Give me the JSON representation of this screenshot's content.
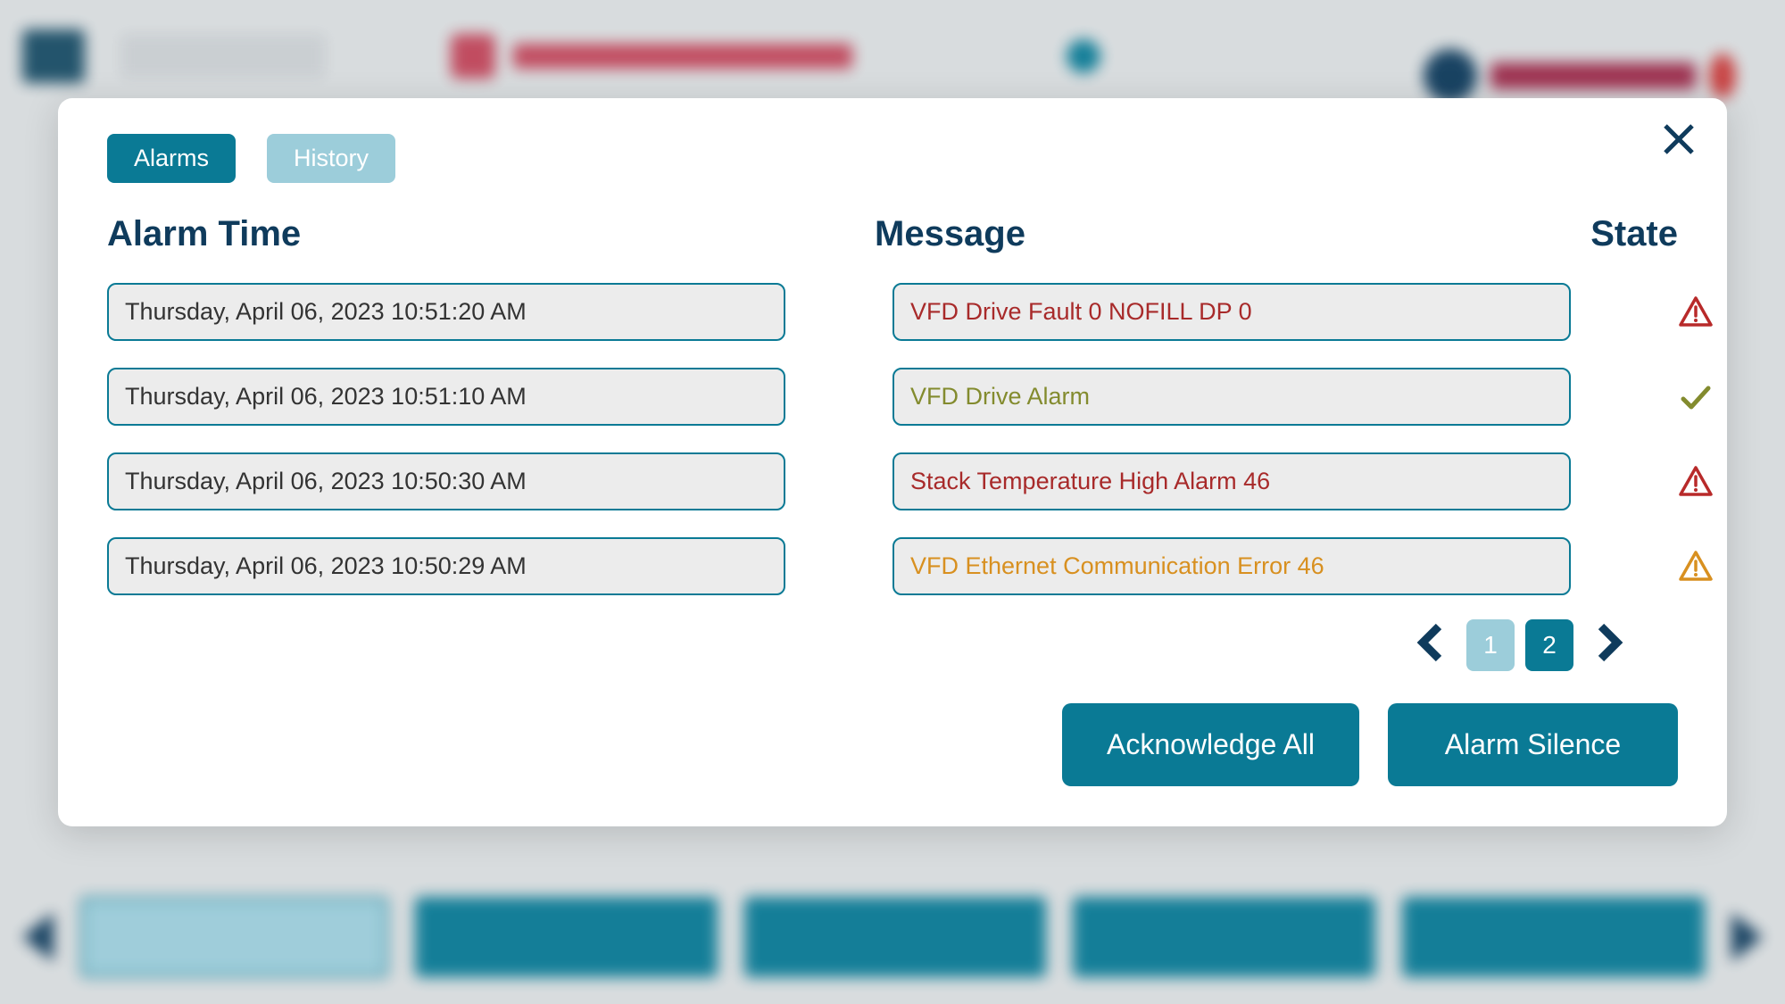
{
  "tabs": {
    "alarms": "Alarms",
    "history": "History"
  },
  "columns": {
    "time": "Alarm Time",
    "message": "Message",
    "state": "State"
  },
  "alarms": [
    {
      "time": "Thursday, April 06, 2023 10:51:20 AM",
      "message": "VFD Drive Fault 0 NOFILL DP 0",
      "msg_class": "error",
      "state": "alert-error"
    },
    {
      "time": "Thursday, April 06, 2023 10:51:10 AM",
      "message": "VFD Drive Alarm",
      "msg_class": "ok",
      "state": "check"
    },
    {
      "time": "Thursday, April 06, 2023 10:50:30 AM",
      "message": "Stack Temperature High Alarm 46",
      "msg_class": "error",
      "state": "alert-error"
    },
    {
      "time": "Thursday, April 06, 2023 10:50:29 AM",
      "message": "VFD Ethernet Communication Error 46",
      "msg_class": "warning",
      "state": "alert-warning"
    }
  ],
  "pagination": {
    "pages": [
      "1",
      "2"
    ],
    "current": 0
  },
  "buttons": {
    "acknowledge": "Acknowledge All",
    "silence": "Alarm Silence"
  },
  "colors": {
    "accent": "#0a7a95",
    "dark": "#0f3b5c",
    "error": "#a82a2a",
    "ok": "#838b2e",
    "warning": "#d89020"
  }
}
